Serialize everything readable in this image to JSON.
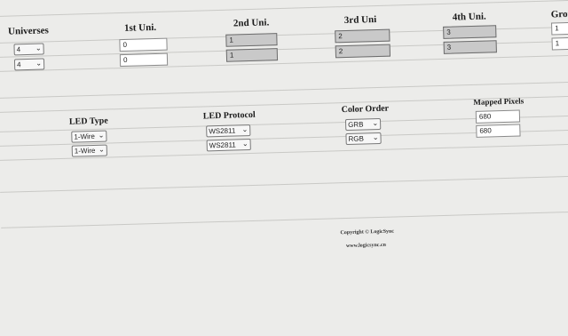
{
  "universes_section": {
    "headers": {
      "universes": "Universes",
      "first": "1st Uni.",
      "second": "2nd Uni.",
      "third": "3rd Uni",
      "fourth": "4th Uni.",
      "group": "Grou"
    },
    "rows": [
      {
        "universes": "4",
        "first": "0",
        "second": "1",
        "third": "2",
        "fourth": "3",
        "group": "1"
      },
      {
        "universes": "4",
        "first": "0",
        "second": "1",
        "third": "2",
        "fourth": "3",
        "group": "1"
      }
    ]
  },
  "led_section": {
    "headers": {
      "led_type": "LED Type",
      "led_protocol": "LED Protocol",
      "color_order": "Color Order",
      "mapped_pixels": "Mapped Pixels"
    },
    "rows": [
      {
        "led_type": "1-Wire",
        "led_protocol": "WS2811",
        "color_order": "GRB",
        "mapped_pixels": "680"
      },
      {
        "led_type": "1-Wire",
        "led_protocol": "WS2811",
        "color_order": "RGB",
        "mapped_pixels": "680"
      }
    ]
  },
  "footer": {
    "copyright": "Copyright © LogicSync",
    "website": "www.logicsync.cn"
  },
  "icons": {
    "dropdown": "chevron-down-icon"
  }
}
